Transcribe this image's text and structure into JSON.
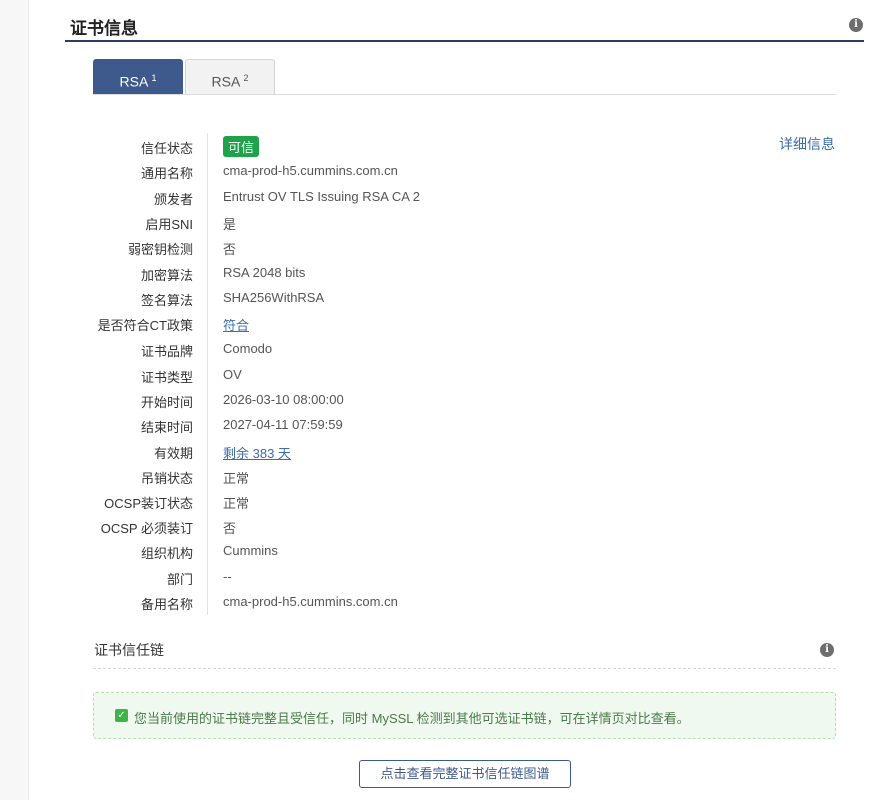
{
  "section": {
    "title": "证书信息"
  },
  "tabs": [
    {
      "label": "RSA",
      "index": "1"
    },
    {
      "label": "RSA",
      "index": "2"
    }
  ],
  "details_link": "详细信息",
  "cert_fields": {
    "trust_status": {
      "label": "信任状态",
      "value": "可信"
    },
    "common_name": {
      "label": "通用名称",
      "value": "cma-prod-h5.cummins.com.cn"
    },
    "issuer": {
      "label": "颁发者",
      "value": "Entrust OV TLS Issuing RSA CA 2"
    },
    "sni": {
      "label": "启用SNI",
      "value": "是"
    },
    "weak_key": {
      "label": "弱密钥检测",
      "value": "否"
    },
    "key_algo": {
      "label": "加密算法",
      "value": "RSA 2048 bits"
    },
    "sig_algo": {
      "label": "签名算法",
      "value": "SHA256WithRSA"
    },
    "ct_policy": {
      "label": "是否符合CT政策",
      "value": "符合"
    },
    "brand": {
      "label": "证书品牌",
      "value": "Comodo"
    },
    "cert_type": {
      "label": "证书类型",
      "value": "OV"
    },
    "start_time": {
      "label": "开始时间",
      "value": "2026-03-10 08:00:00"
    },
    "end_time": {
      "label": "结束时间",
      "value": "2027-04-11 07:59:59"
    },
    "validity": {
      "label": "有效期",
      "value": "剩余 383 天"
    },
    "revocation": {
      "label": "吊销状态",
      "value": "正常"
    },
    "ocsp_stapling": {
      "label": "OCSP装订状态",
      "value": "正常"
    },
    "ocsp_must_staple": {
      "label": "OCSP 必须装订",
      "value": "否"
    },
    "organization": {
      "label": "组织机构",
      "value": "Cummins"
    },
    "department": {
      "label": "部门",
      "value": "--"
    },
    "alt_names": {
      "label": "备用名称",
      "value": "cma-prod-h5.cummins.com.cn"
    }
  },
  "chain": {
    "title": "证书信任链",
    "notice": "您当前使用的证书链完整且受信任，同时 MySSL 检测到其他可选证书链，可在详情页对比查看。",
    "button_label": "点击查看完整证书信任链图谱"
  },
  "icons": {
    "info": "info-icon",
    "check": "check-icon"
  },
  "colors": {
    "accent": "#3e5a8d",
    "trusted_badge": "#1ea24a",
    "link": "#3d6da8"
  }
}
